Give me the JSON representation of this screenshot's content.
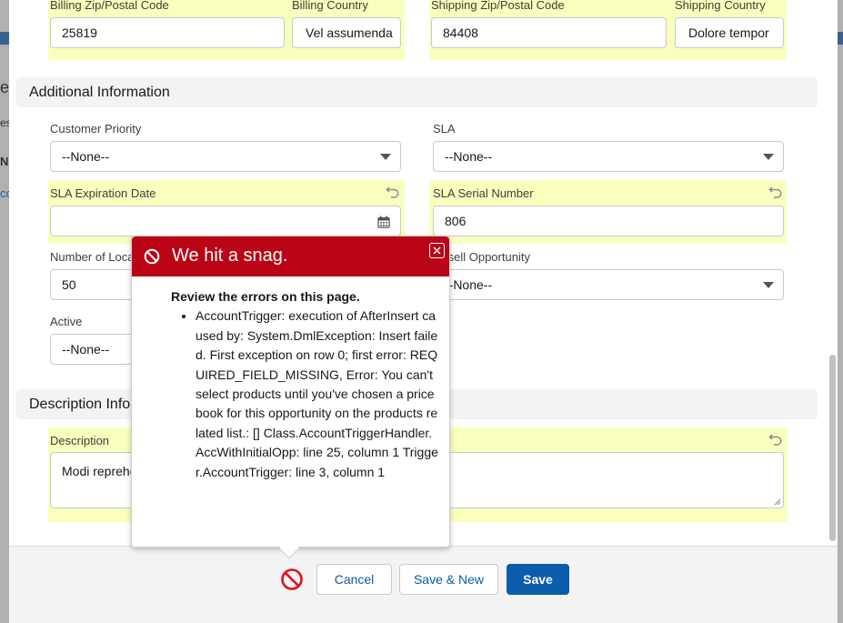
{
  "background": {
    "fragments": [
      "e",
      "es",
      "N",
      "co"
    ]
  },
  "address": {
    "billing_zip_label": "Billing Zip/Postal Code",
    "billing_zip_value": "25819",
    "billing_country_label": "Billing Country",
    "billing_country_value": "Vel assumenda",
    "shipping_zip_label": "Shipping Zip/Postal Code",
    "shipping_zip_value": "84408",
    "shipping_country_label": "Shipping Country",
    "shipping_country_value": "Dolore tempor"
  },
  "additional_info": {
    "section_title": "Additional Information",
    "customer_priority_label": "Customer Priority",
    "customer_priority_value": "--None--",
    "sla_label": "SLA",
    "sla_value": "--None--",
    "sla_expiration_label": "SLA Expiration Date",
    "sla_expiration_value": "",
    "sla_serial_label": "SLA Serial Number",
    "sla_serial_value": "806",
    "num_locations_label": "Number of Locations",
    "num_locations_value": "50",
    "upsell_label": "Upsell Opportunity",
    "upsell_value": "--None--",
    "active_label": "Active",
    "active_value": "--None--"
  },
  "description_info": {
    "section_title": "Description Information",
    "description_label": "Description",
    "description_value": "Modi reprehenderit"
  },
  "error_popover": {
    "title": "We hit a snag.",
    "heading": "Review the errors on this page.",
    "errors": [
      "AccountTrigger: execution of AfterInsert caused by: System.DmlException: Insert failed. First exception on row 0; first error: REQUIRED_FIELD_MISSING, Error: You can't select products until you've chosen a price book for this opportunity on the products related list.: [] Class.AccountTriggerHandler.AccWithInitialOpp: line 25, column 1 Trigger.AccountTrigger: line 3, column 1"
    ]
  },
  "footer": {
    "cancel_label": "Cancel",
    "save_new_label": "Save & New",
    "save_label": "Save"
  },
  "colors": {
    "highlight": "#faffbd",
    "error_red": "#ba0517",
    "brand": "#0b5cab"
  }
}
